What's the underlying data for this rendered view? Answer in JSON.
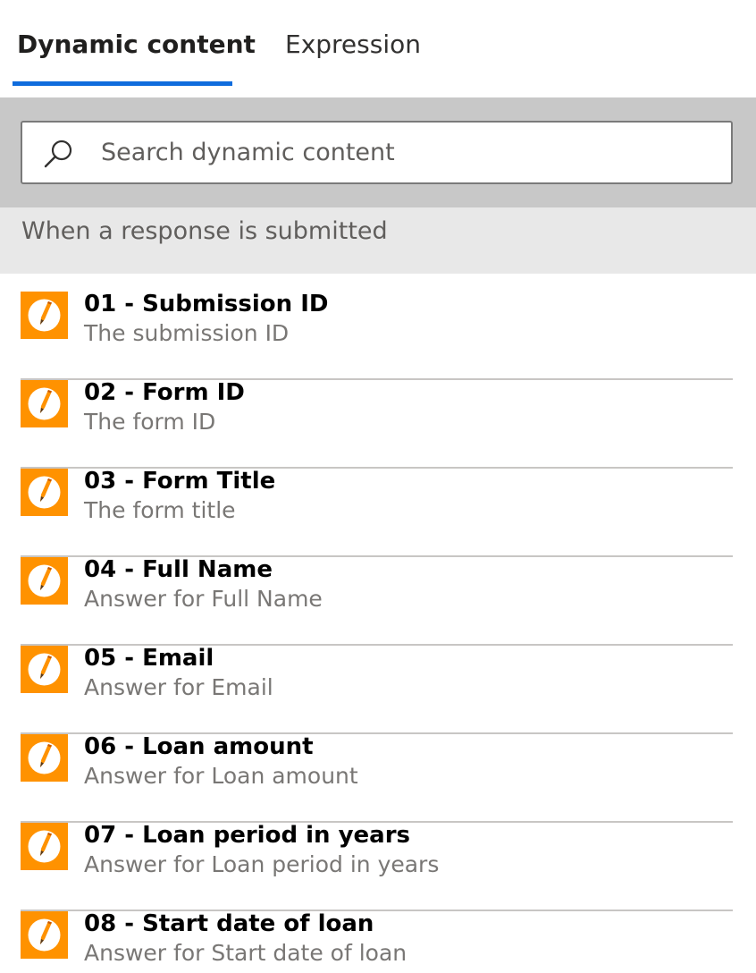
{
  "tabs": [
    {
      "label": "Dynamic content",
      "active": true
    },
    {
      "label": "Expression",
      "active": false
    }
  ],
  "search": {
    "placeholder": "Search dynamic content",
    "value": ""
  },
  "section": {
    "title": "When a response is submitted"
  },
  "items": [
    {
      "title": "01 - Submission ID",
      "description": "The submission ID"
    },
    {
      "title": "02 - Form ID",
      "description": "The form ID"
    },
    {
      "title": "03 - Form Title",
      "description": "The form title"
    },
    {
      "title": "04 - Full Name",
      "description": "Answer for Full Name"
    },
    {
      "title": "05 - Email",
      "description": "Answer for Email"
    },
    {
      "title": "06 - Loan amount",
      "description": "Answer for Loan amount"
    },
    {
      "title": "07 - Loan period in years",
      "description": "Answer for Loan period in years"
    },
    {
      "title": "08 - Start date of loan",
      "description": "Answer for Start date of loan"
    }
  ],
  "colors": {
    "accent": "#0f6cdd",
    "item_icon_bg": "#ff9200"
  },
  "icons": {
    "search": "search-icon",
    "item": "forms-pencil-icon"
  }
}
